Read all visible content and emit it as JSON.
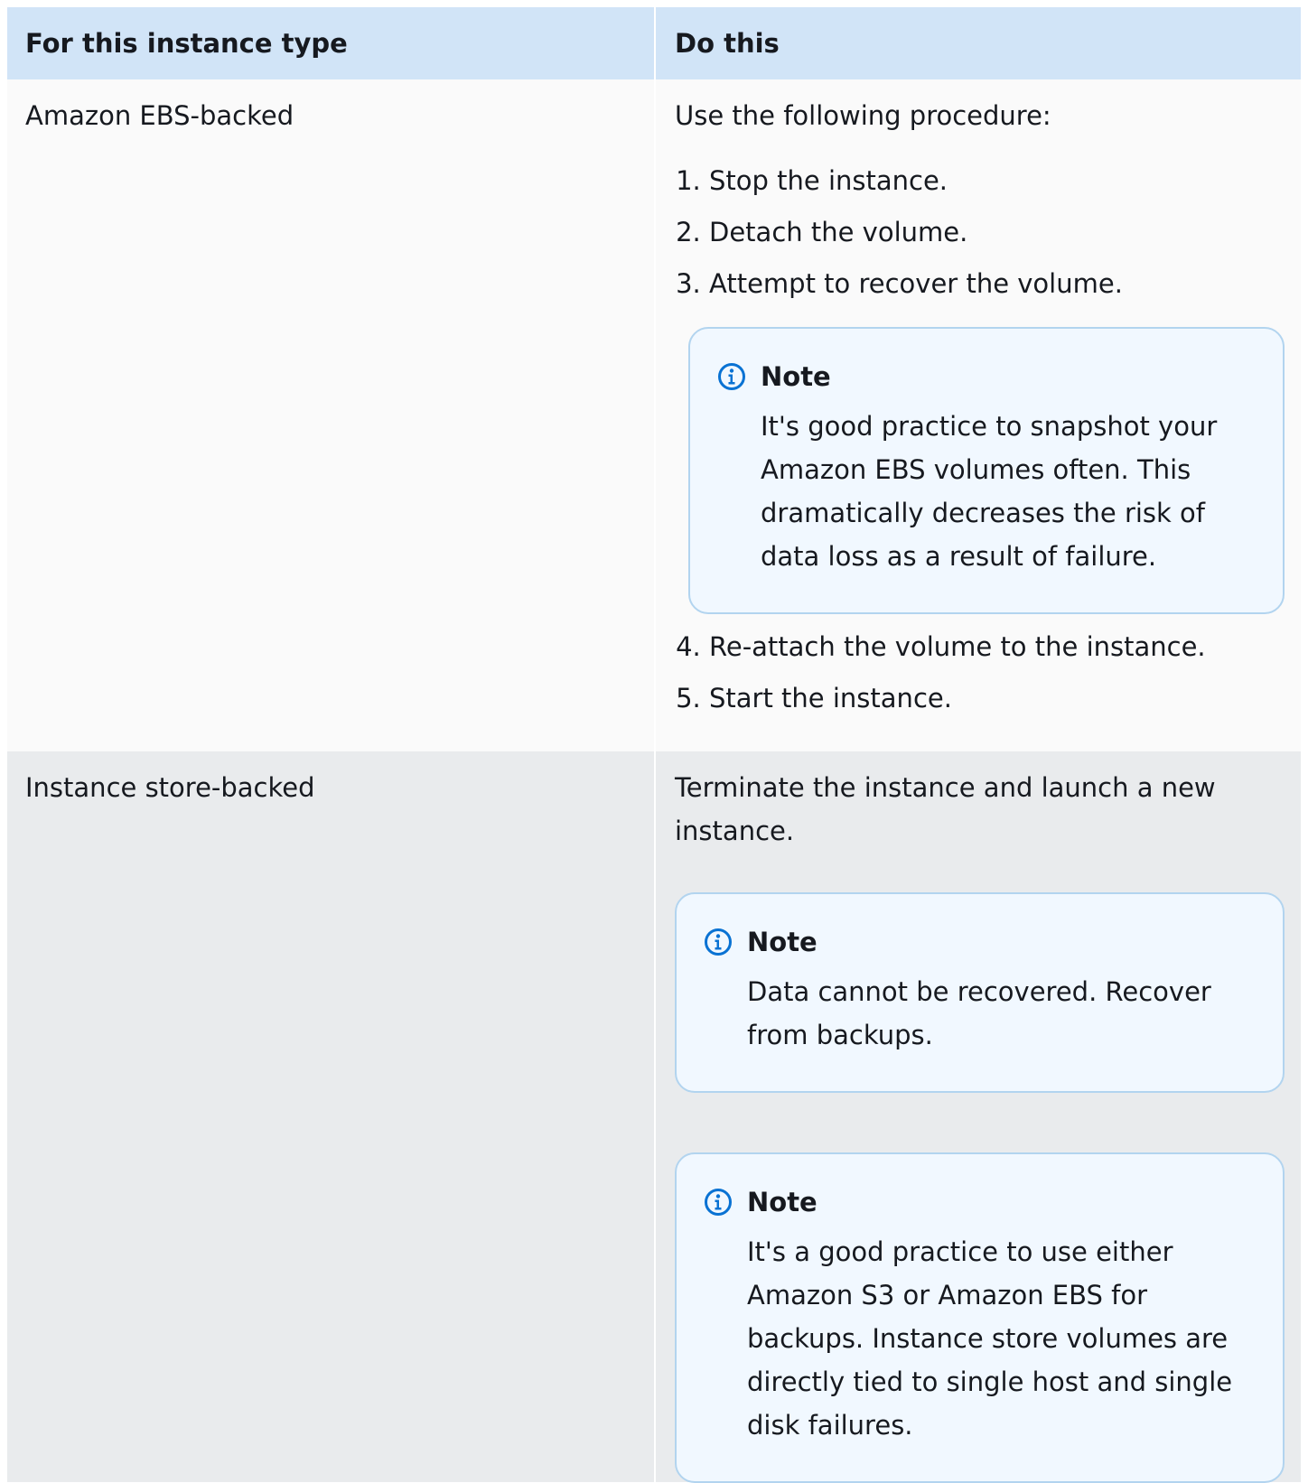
{
  "table": {
    "headers": {
      "col1": "For this instance type",
      "col2": "Do this"
    },
    "rows": [
      {
        "type": "Amazon EBS-backed",
        "intro": "Use the following procedure:",
        "steps_before_note": [
          "Stop the instance.",
          "Detach the volume.",
          "Attempt to recover the volume."
        ],
        "note": {
          "title": "Note",
          "text": "It's good practice to snapshot your Amazon EBS volumes often. This dramatically decreases the risk of data loss as a result of failure."
        },
        "steps_after_note": [
          "Re-attach the volume to the instance.",
          "Start the instance."
        ]
      },
      {
        "type": "Instance store-backed",
        "intro": "Terminate the instance and launch a new instance.",
        "notes": [
          {
            "title": "Note",
            "text": "Data cannot be recovered. Recover from backups."
          },
          {
            "title": "Note",
            "text": "It's a good practice to use either Amazon S3 or Amazon EBS for backups. Instance store volumes are directly tied to single host and single disk failures."
          }
        ]
      }
    ]
  },
  "icons": {
    "note_icon": "info-icon"
  },
  "colors": {
    "header_bg": "#d1e4f7",
    "row1_bg": "#fafafa",
    "row2_bg": "#e9ebed",
    "note_bg": "#f1f8ff",
    "note_border": "#b2d4ef",
    "icon_color": "#0972d3"
  }
}
